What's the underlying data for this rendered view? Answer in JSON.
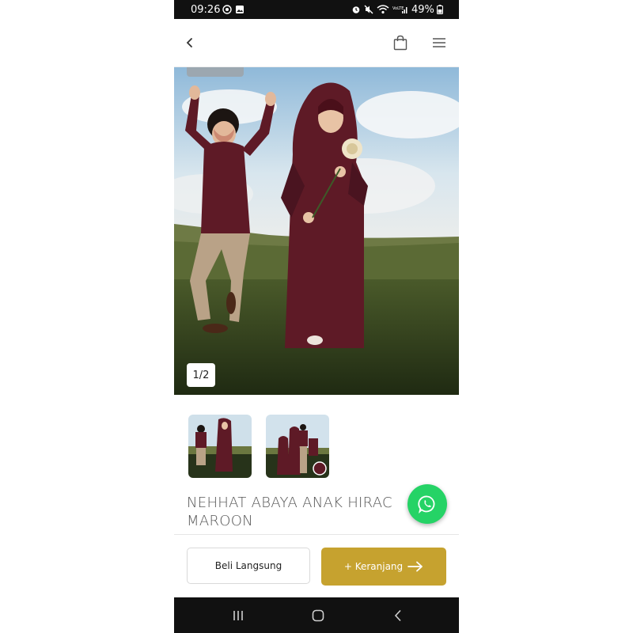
{
  "status_bar": {
    "time": "09:26",
    "battery": "49%"
  },
  "header": {
    "back_icon": "chevron-left-icon",
    "cart_icon": "shopping-bag-icon",
    "menu_icon": "hamburger-menu-icon"
  },
  "gallery": {
    "counter": "1/2",
    "thumbnails": [
      "thumbnail-1",
      "thumbnail-2"
    ]
  },
  "product": {
    "title_line1": "NEHHAT ABAYA ANAK HIRAC",
    "title_line2": "MAROON"
  },
  "actions": {
    "buy_now_label": "Beli Langsung",
    "add_to_cart_label": "+ Keranjang"
  },
  "colors": {
    "accent": "#c6a22f",
    "whatsapp": "#25d366",
    "maroon": "#5e1a26"
  }
}
